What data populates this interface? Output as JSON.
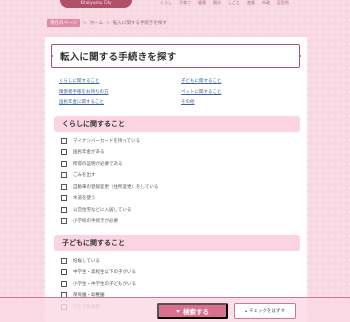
{
  "header": {
    "logo_text": "Kitakyushu City",
    "nav": [
      "くらし",
      "子育て",
      "健康",
      "観光",
      "しごと",
      "産業",
      "市政",
      "区役所"
    ]
  },
  "breadcrumb": {
    "current": "現在のページ",
    "items": [
      "ホーム",
      "転入に関する手続きを探す"
    ]
  },
  "page": {
    "title": "転入に関する手続きを探す"
  },
  "links": [
    "くらしに関すること",
    "子どもに関すること",
    "障害者手帳をお持ちの方",
    "ペットに関すること",
    "国民年金に関すること",
    "その他"
  ],
  "sections": [
    {
      "title": "くらしに関すること",
      "items": [
        "マイナンバーカードを持っている",
        "国民年金がある",
        "所得の証明が必要である",
        "ごみを出す",
        "自動車の登録変更（住所変更）をしている",
        "水道を使う",
        "公営住宅などに入居している",
        "小学校の手続きが必要"
      ]
    },
    {
      "title": "子どもに関すること",
      "items": [
        "妊娠している",
        "中学生・高校生以下の子がいる",
        "小学生・中学生の子どもがいる",
        "保育園・幼稚園",
        "ひとり親家庭"
      ]
    }
  ],
  "actions": {
    "search_label": "検索する",
    "clear_label": "チェックをはずす"
  },
  "colors": {
    "accent": "#b14f6c",
    "section_bg": "#fbd3e1",
    "page_bg": "#f8d8e3",
    "button": "#d9708f",
    "link": "#3d63a8"
  }
}
